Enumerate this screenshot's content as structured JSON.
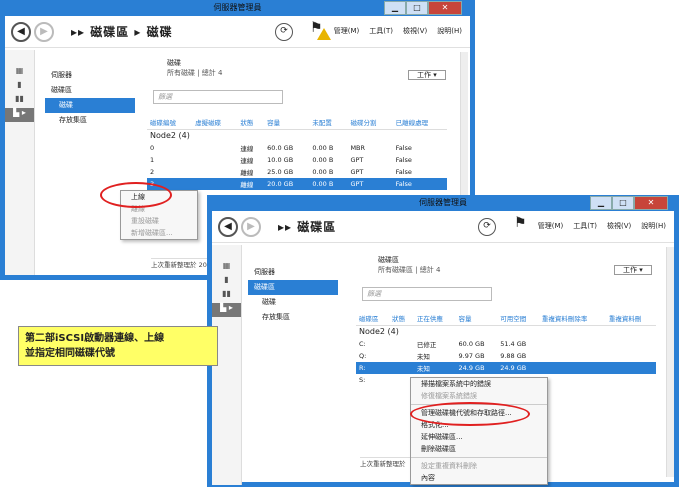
{
  "back_window": {
    "title": "伺服器管理員",
    "breadcrumb": [
      "磁碟區",
      "磁碟"
    ],
    "menus": [
      "管理(M)",
      "工具(T)",
      "檢視(V)",
      "說明(H)"
    ],
    "nav_items": [
      "伺服器",
      "磁碟區",
      "磁碟",
      "存放集區"
    ],
    "content_title": "磁碟",
    "content_subtitle": "所有磁碟 | 總計 4",
    "task_button": "工作 ▾",
    "filter_placeholder": "篩選",
    "columns": [
      "磁碟編號",
      "虛擬磁碟",
      "狀態",
      "容量",
      "未配置",
      "磁碟分割",
      "已離線處理"
    ],
    "group": "Node2 (4)",
    "rows": [
      [
        "0",
        "",
        "連線",
        "60.0 GB",
        "0.00 B",
        "MBR",
        "False"
      ],
      [
        "1",
        "",
        "連線",
        "10.0 GB",
        "0.00 B",
        "GPT",
        "False"
      ],
      [
        "2",
        "",
        "離線",
        "25.0 GB",
        "0.00 B",
        "GPT",
        "False"
      ],
      [
        "3",
        "",
        "離線",
        "20.0 GB",
        "0.00 B",
        "GPT",
        "False"
      ]
    ],
    "context_menu": [
      "上線",
      "離線",
      "重設磁碟",
      "新增磁碟區..."
    ],
    "status": "上次重新整理於 20"
  },
  "front_window": {
    "title": "伺服器管理員",
    "breadcrumb": [
      "磁碟區"
    ],
    "menus": [
      "管理(M)",
      "工具(T)",
      "檢視(V)",
      "說明(H)"
    ],
    "nav_items": [
      "伺服器",
      "磁碟區",
      "磁碟",
      "存放集區"
    ],
    "content_title": "磁碟區",
    "content_subtitle": "所有磁碟區 | 總計 4",
    "task_button": "工作 ▾",
    "filter_placeholder": "篩選",
    "columns": [
      "磁碟區",
      "狀態",
      "正在供應",
      "容量",
      "可用空間",
      "重複資料刪除率",
      "重複資料刪"
    ],
    "group": "Node2 (4)",
    "rows": [
      [
        "C:",
        "",
        "已修正",
        "60.0 GB",
        "51.4 GB",
        "",
        ""
      ],
      [
        "Q:",
        "",
        "未知",
        "9.97 GB",
        "9.88 GB",
        "",
        ""
      ],
      [
        "R:",
        "",
        "未知",
        "24.9 GB",
        "24.9 GB",
        "",
        ""
      ],
      [
        "S:",
        "",
        "",
        "",
        "",
        "",
        ""
      ]
    ],
    "context_menu": [
      "掃描檔案系統中的錯誤",
      "修復檔案系統錯誤",
      "管理磁碟機代號和存取路徑...",
      "格式化...",
      "延伸磁碟區...",
      "刪除磁碟區",
      "設定重複資料刪除",
      "內容"
    ],
    "status": "上次重新整理於"
  },
  "note": {
    "line1": "第二部iSCSI啟動器連線、上線",
    "line2": "並指定相同磁碟代號"
  }
}
